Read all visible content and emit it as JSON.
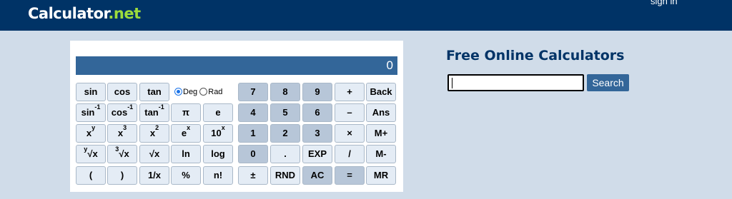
{
  "header": {
    "logo_main": "Calculator",
    "logo_dot": ".",
    "logo_suffix": "net",
    "signin": "sign in"
  },
  "calculator": {
    "display": "0",
    "angle": {
      "deg_label": "Deg",
      "rad_label": "Rad",
      "selected": "Deg"
    },
    "keys": {
      "sin": "sin",
      "cos": "cos",
      "tan": "tan",
      "asin_base": "sin",
      "asin_sup": "-1",
      "acos_base": "cos",
      "acos_sup": "-1",
      "atan_base": "tan",
      "atan_sup": "-1",
      "pi": "π",
      "e": "e",
      "xy_base": "x",
      "xy_sup": "y",
      "x3_base": "x",
      "x3_sup": "3",
      "x2_base": "x",
      "x2_sup": "2",
      "ex_base": "e",
      "ex_sup": "x",
      "tenx_base": "10",
      "tenx_sup": "x",
      "yroot_pre": "y",
      "yroot_body": "√x",
      "cuberoot_pre": "3",
      "cuberoot_body": "√x",
      "sqrt": "√x",
      "ln": "ln",
      "log": "log",
      "open_paren": "(",
      "close_paren": ")",
      "reciprocal": "1/x",
      "percent": "%",
      "factorial": "n!",
      "n7": "7",
      "n8": "8",
      "n9": "9",
      "plus": "+",
      "back": "Back",
      "n4": "4",
      "n5": "5",
      "n6": "6",
      "minus": "–",
      "ans": "Ans",
      "n1": "1",
      "n2": "2",
      "n3": "3",
      "multiply": "×",
      "mplus": "M+",
      "n0": "0",
      "dot": ".",
      "exp": "EXP",
      "divide": "/",
      "mminus": "M-",
      "plusminus": "±",
      "rnd": "RND",
      "ac": "AC",
      "equals": "=",
      "mr": "MR"
    }
  },
  "sidebar": {
    "title": "Free Online Calculators",
    "search_value": "",
    "search_button": "Search"
  },
  "colors": {
    "header_bg": "#003366",
    "logo_accent": "#9ddc3c",
    "display_bg": "#336699",
    "page_bg": "#d0dce9",
    "key_light": "#e4ecf5",
    "key_dark": "#b7c6d8",
    "title_color": "#003366"
  }
}
